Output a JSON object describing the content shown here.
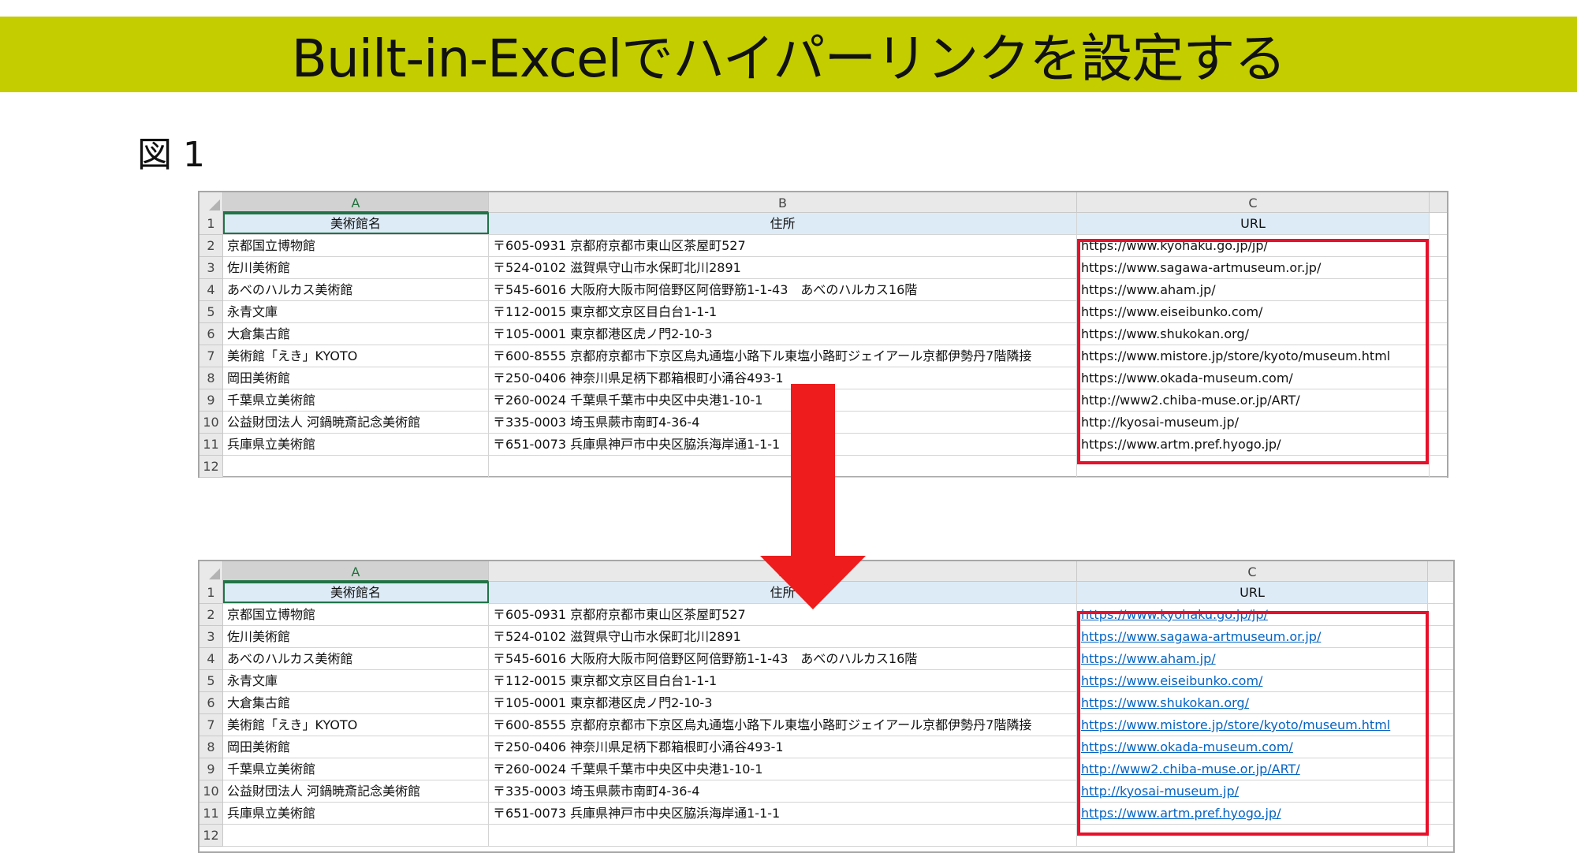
{
  "banner": {
    "title": "Built-in-Excelでハイパーリンクを設定する"
  },
  "figure_label": "図 1",
  "columns": [
    "A",
    "B",
    "C"
  ],
  "header_row": {
    "a": "美術館名",
    "b": "住所",
    "c": "URL"
  },
  "row_numbers": [
    "1",
    "2",
    "3",
    "4",
    "5",
    "6",
    "7",
    "8",
    "9",
    "10",
    "11",
    "12"
  ],
  "rows": [
    {
      "name": "京都国立博物館",
      "address": "〒605-0931 京都府京都市東山区茶屋町527",
      "url": "https://www.kyohaku.go.jp/jp/"
    },
    {
      "name": "佐川美術館",
      "address": "〒524-0102 滋賀県守山市水保町北川2891",
      "url": "https://www.sagawa-artmuseum.or.jp/"
    },
    {
      "name": "あべのハルカス美術館",
      "address": "〒545-6016 大阪府大阪市阿倍野区阿倍野筋1-1-43　あべのハルカス16階",
      "url": "https://www.aham.jp/"
    },
    {
      "name": "永青文庫",
      "address": "〒112-0015 東京都文京区目白台1-1-1",
      "url": "https://www.eiseibunko.com/"
    },
    {
      "name": "大倉集古館",
      "address": "〒105-0001 東京都港区虎ノ門2-10-3",
      "url": "https://www.shukokan.org/"
    },
    {
      "name": "美術館「えき」KYOTO",
      "address": "〒600-8555 京都府京都市下京区烏丸通塩小路下ル東塩小路町ジェイアール京都伊勢丹7階隣接",
      "url": "https://www.mistore.jp/store/kyoto/museum.html"
    },
    {
      "name": "岡田美術館",
      "address": "〒250-0406 神奈川県足柄下郡箱根町小涌谷493-1",
      "url": "https://www.okada-museum.com/"
    },
    {
      "name": "千葉県立美術館",
      "address": "〒260-0024 千葉県千葉市中央区中央港1-10-1",
      "url": "http://www2.chiba-muse.or.jp/ART/"
    },
    {
      "name": "公益財団法人 河鍋暁斎記念美術館",
      "address": "〒335-0003 埼玉県蕨市南町4-36-4",
      "url": "http://kyosai-museum.jp/"
    },
    {
      "name": "兵庫県立美術館",
      "address": "〒651-0073 兵庫県神戸市中央区脇浜海岸通1-1-1",
      "url": "https://www.artm.pref.hyogo.jp/"
    }
  ],
  "colors": {
    "banner": "#c3cd00",
    "highlight_box": "#e8102a",
    "arrow": "#ee1c1c",
    "link": "#0563c1"
  },
  "icons": {
    "arrow": "down-arrow-icon"
  }
}
